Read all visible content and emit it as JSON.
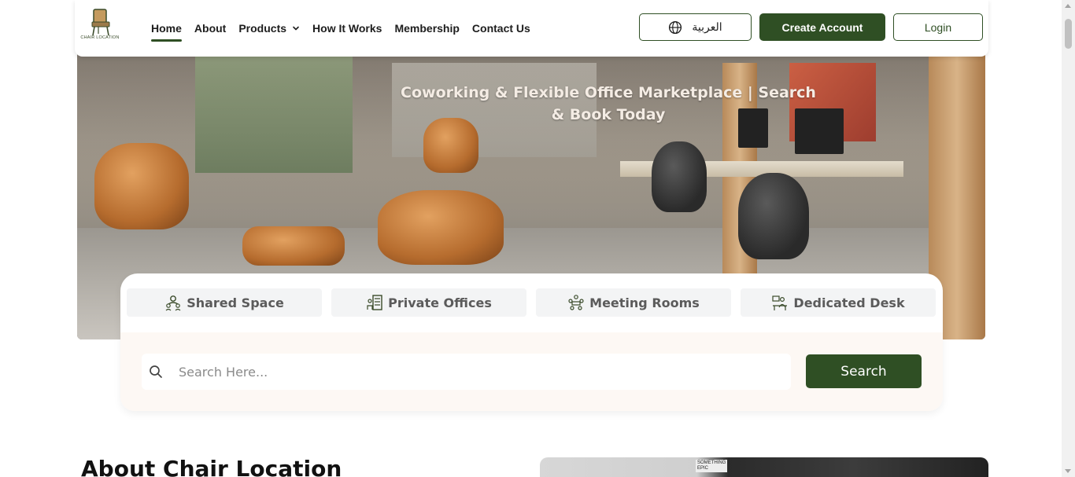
{
  "brand": {
    "logo_text": "CHAIR LOCATION",
    "color_primary": "#2f4f24"
  },
  "nav": {
    "items": [
      {
        "label": "Home",
        "active": true
      },
      {
        "label": "About"
      },
      {
        "label": "Products",
        "has_dropdown": true,
        "icon": "chevron-down-icon"
      },
      {
        "label": "How It Works"
      },
      {
        "label": "Membership"
      },
      {
        "label": "Contact Us"
      }
    ]
  },
  "header_actions": {
    "language_label": "العربية",
    "language_icon": "globe-icon",
    "create_account_label": "Create Account",
    "login_label": "Login"
  },
  "hero": {
    "title": "Coworking & Flexible Office Marketplace | Search & Book Today"
  },
  "search": {
    "tabs": [
      {
        "label": "Shared Space",
        "icon": "shared-space-icon"
      },
      {
        "label": "Private Offices",
        "icon": "private-offices-icon"
      },
      {
        "label": "Meeting Rooms",
        "icon": "meeting-rooms-icon"
      },
      {
        "label": "Dedicated Desk",
        "icon": "dedicated-desk-icon"
      }
    ],
    "placeholder": "Search Here...",
    "value": "",
    "search_icon": "search-icon",
    "button_label": "Search"
  },
  "about": {
    "title": "About Chair Location",
    "image_sign_text": "SOMETHING EPIC"
  }
}
